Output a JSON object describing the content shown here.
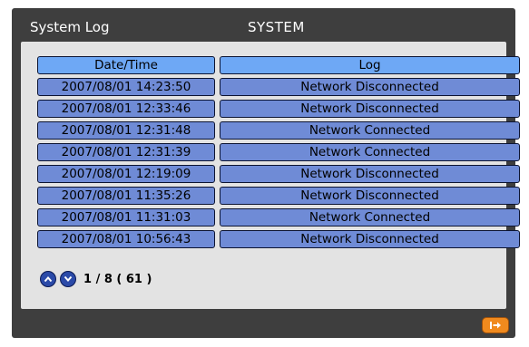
{
  "window": {
    "title": "System Log",
    "section": "SYSTEM"
  },
  "table": {
    "headers": {
      "datetime": "Date/Time",
      "log": "Log"
    },
    "rows": [
      {
        "datetime": "2007/08/01 14:23:50",
        "log": "Network Disconnected"
      },
      {
        "datetime": "2007/08/01 12:33:46",
        "log": "Network Disconnected"
      },
      {
        "datetime": "2007/08/01 12:31:48",
        "log": "Network Connected"
      },
      {
        "datetime": "2007/08/01 12:31:39",
        "log": "Network Connected"
      },
      {
        "datetime": "2007/08/01 12:19:09",
        "log": "Network Disconnected"
      },
      {
        "datetime": "2007/08/01 11:35:26",
        "log": "Network Disconnected"
      },
      {
        "datetime": "2007/08/01 11:31:03",
        "log": "Network Connected"
      },
      {
        "datetime": "2007/08/01 10:56:43",
        "log": "Network Disconnected"
      }
    ]
  },
  "pager": {
    "text": "1 / 8 ( 61 )",
    "up_icon": "chevron-up-icon",
    "down_icon": "chevron-down-icon"
  },
  "exit": {
    "icon": "exit-icon"
  },
  "colors": {
    "frame": "#3e3e3e",
    "panel": "#e3e3e3",
    "header_cell": "#6ea8f5",
    "row_cell": "#6f8bd6",
    "nav_button": "#2b4aa8",
    "exit_button": "#f08a1e"
  }
}
